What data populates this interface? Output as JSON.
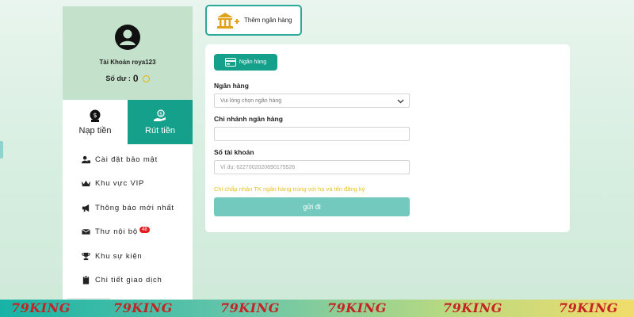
{
  "profile": {
    "account_name": "Tài Khoản roya123",
    "balance_label": "Số dư :",
    "balance_value": "0"
  },
  "actions": {
    "deposit": "Nạp tiền",
    "withdraw": "Rút tiền"
  },
  "menu": [
    {
      "label": "Cài đặt bảo mật",
      "icon": "user-lock-icon"
    },
    {
      "label": "Khu vực VIP",
      "icon": "crown-icon"
    },
    {
      "label": "Thông báo mới nhất",
      "icon": "megaphone-icon"
    },
    {
      "label": "Thư nội bộ",
      "icon": "envelope-icon",
      "badge": "48"
    },
    {
      "label": "Khu sự kiện",
      "icon": "trophy-icon"
    },
    {
      "label": "Chi tiết giao dịch",
      "icon": "clipboard-icon"
    }
  ],
  "add_bank": {
    "label": "Thêm ngân hàng"
  },
  "form": {
    "tab_label": "Ngân hàng",
    "bank_label": "Ngân hàng",
    "bank_select_value": "Vui lòng chọn ngân hàng",
    "branch_label": "Chi nhánh ngân hàng",
    "branch_value": "",
    "account_label": "Số tài khoản",
    "account_placeholder": "Ví dụ:  6227002020690175526",
    "note": "Chỉ chấp nhận TK ngân hàng trùng với họ và tên đăng ký",
    "submit_label": "gửi đi"
  },
  "brand": {
    "text": "79KING",
    "count": 6
  },
  "colors": {
    "accent": "#15a08c",
    "profile_bg": "#c4e2cb",
    "note": "#e6c020",
    "submit": "#73c9bd",
    "badge": "#e41e1e"
  }
}
